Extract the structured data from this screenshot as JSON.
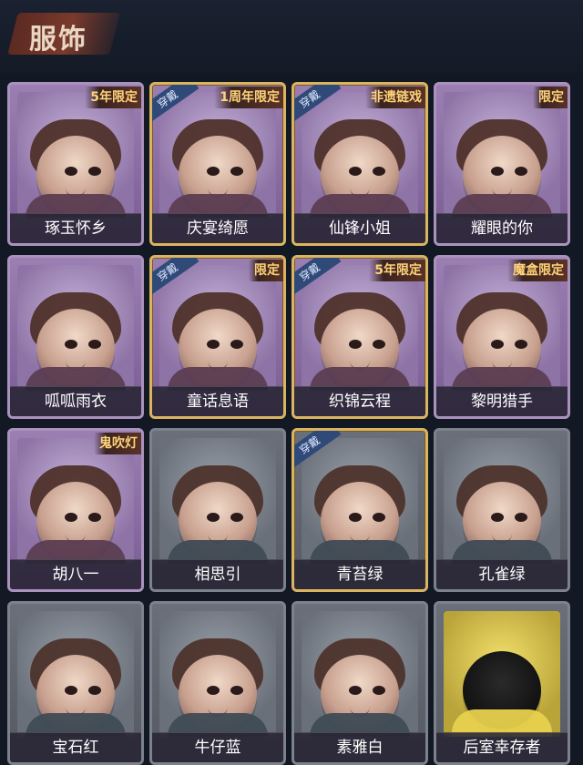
{
  "header": {
    "title": "服饰"
  },
  "grid": {
    "items": [
      {
        "name": "琢玉怀乡",
        "badge": "5年限定",
        "status": "",
        "rarity": "purple",
        "selected": false
      },
      {
        "name": "庆宴绮愿",
        "badge": "1周年限定",
        "status": "穿戴",
        "rarity": "purple",
        "selected": true
      },
      {
        "name": "仙锋小姐",
        "badge": "非遗链戏",
        "status": "穿戴",
        "rarity": "purple",
        "selected": true
      },
      {
        "name": "耀眼的你",
        "badge": "限定",
        "status": "",
        "rarity": "purple",
        "selected": false
      },
      {
        "name": "呱呱雨衣",
        "badge": "",
        "status": "",
        "rarity": "purple",
        "selected": false
      },
      {
        "name": "童话息语",
        "badge": "限定",
        "status": "穿戴",
        "rarity": "purple",
        "selected": true
      },
      {
        "name": "织锦云程",
        "badge": "5年限定",
        "status": "穿戴",
        "rarity": "purple",
        "selected": true
      },
      {
        "name": "黎明猎手",
        "badge": "魔盒限定",
        "status": "",
        "rarity": "purple",
        "selected": false
      },
      {
        "name": "胡八一",
        "badge": "鬼吹灯",
        "status": "",
        "rarity": "purple",
        "selected": false
      },
      {
        "name": "相思引",
        "badge": "",
        "status": "",
        "rarity": "gray",
        "selected": false
      },
      {
        "name": "青苔绿",
        "badge": "",
        "status": "穿戴",
        "rarity": "gray",
        "selected": true
      },
      {
        "name": "孔雀绿",
        "badge": "",
        "status": "",
        "rarity": "gray",
        "selected": false
      },
      {
        "name": "宝石红",
        "badge": "",
        "status": "",
        "rarity": "gray",
        "selected": false
      },
      {
        "name": "牛仔蓝",
        "badge": "",
        "status": "",
        "rarity": "gray",
        "selected": false
      },
      {
        "name": "素雅白",
        "badge": "",
        "status": "",
        "rarity": "gray",
        "selected": false
      },
      {
        "name": "后室幸存者",
        "badge": "",
        "status": "",
        "rarity": "gray",
        "selected": false
      }
    ]
  }
}
